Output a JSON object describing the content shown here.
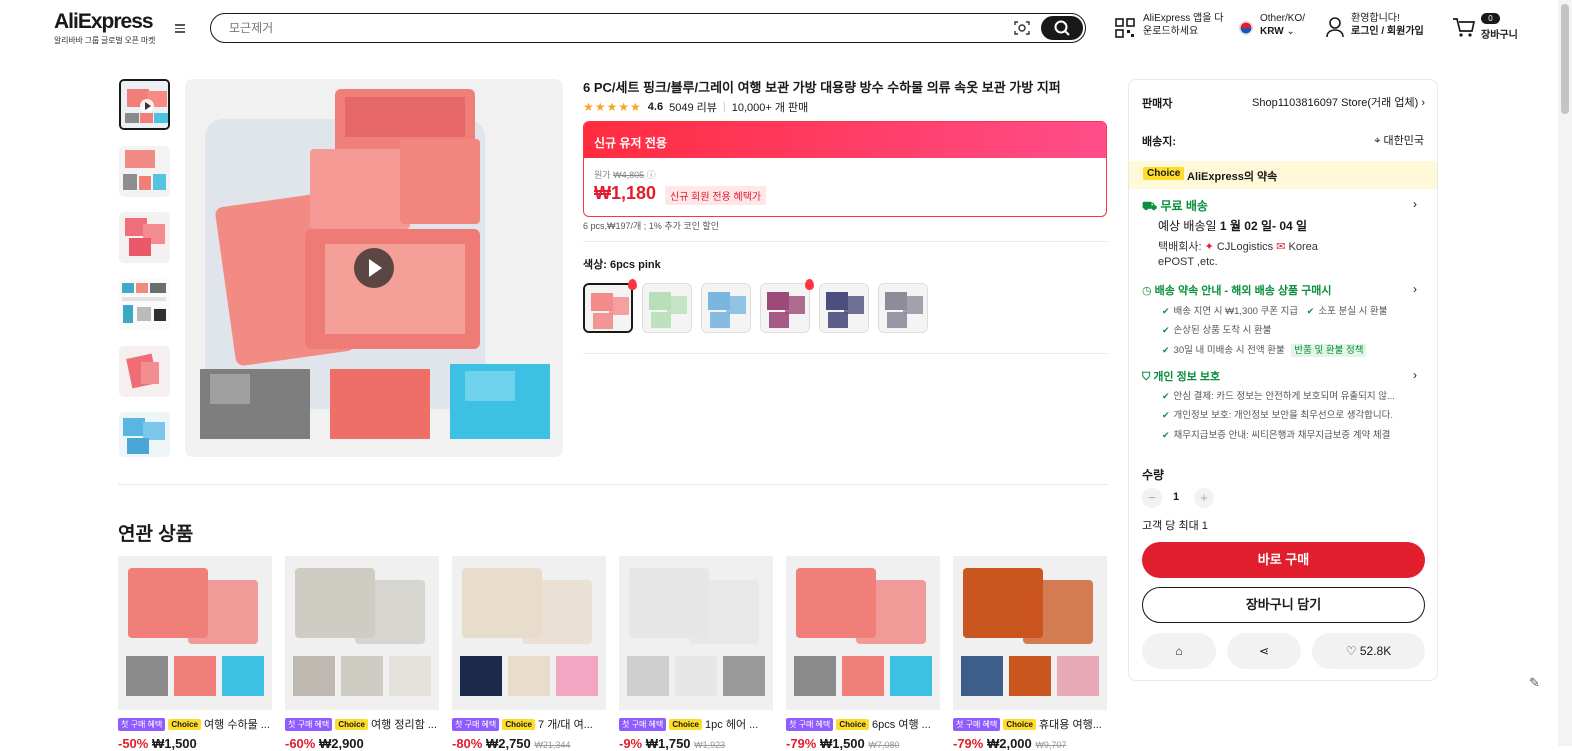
{
  "header": {
    "brand": "AliExpress",
    "brand_sub": "알리바바 그룹 글로벌 오픈 마켓",
    "search_placeholder": "모근제거",
    "app_line1": "AliExpress 앱을 다",
    "app_line2": "운로드하세요",
    "region_line1": "Other/KO/",
    "region_line2": "KRW",
    "login_line1": "환영합니다!",
    "login_line2": "로그인 / 회원가입",
    "cart_count": "0",
    "cart_label": "장바구니"
  },
  "product": {
    "title": "6 PC/세트 핑크/블루/그레이 여행 보관 가방 대용량 방수 수하물 의류 속옷 보관 가방 지퍼",
    "rating": "4.6",
    "reviews": "5049 리뷰",
    "sold": "10,000+ 개 판매",
    "promo_title": "신규 유저 전용",
    "orig_label": "원가",
    "orig_price": "₩4,805",
    "price": "₩1,180",
    "new_badge": "신규 회원 전용 혜택가",
    "unit_note": "6 pcs,₩197/개 ; 1% 추가 코인 할인",
    "color_label": "색상:",
    "color_value": "6pcs pink",
    "swatches": [
      {
        "name": "pink",
        "color": "#f48b8b"
      },
      {
        "name": "green",
        "color": "#b9dfb9"
      },
      {
        "name": "blue",
        "color": "#79b7e0"
      },
      {
        "name": "purple",
        "color": "#9c4a78"
      },
      {
        "name": "navy",
        "color": "#4c4f7e"
      },
      {
        "name": "gray",
        "color": "#8c8d99"
      }
    ]
  },
  "related": {
    "heading": "연관 상품",
    "tag_first": "첫 구매 혜택",
    "tag_choice": "Choice",
    "items": [
      {
        "title": "여행 수하물 ...",
        "pct": "-50%",
        "price": "₩1,500",
        "old": ""
      },
      {
        "title": "여행 정리함 ...",
        "pct": "-60%",
        "price": "₩2,900",
        "old": ""
      },
      {
        "title": "7 개/대 여...",
        "pct": "-80%",
        "price": "₩2,750",
        "old": "₩21,344"
      },
      {
        "title": "1pc 헤어 ...",
        "pct": "-9%",
        "price": "₩1,750",
        "old": "₩1,923"
      },
      {
        "title": "6pcs 여행 ...",
        "pct": "-79%",
        "price": "₩1,500",
        "old": "₩7,080"
      },
      {
        "title": "휴대용 여행...",
        "pct": "-79%",
        "price": "₩2,000",
        "old": "₩9,707"
      }
    ]
  },
  "panel": {
    "seller_label": "판매자",
    "seller_value": "Shop1103816097 Store(거래 업체)",
    "ship_label": "배송지:",
    "ship_value": "대한민국",
    "choice_tag": "Choice",
    "choice_text": "AliExpress의 약속",
    "free_ship": "무료 배송",
    "eta_prefix": "예상 배송일",
    "eta": "1 월 02 일- 04 일",
    "courier_label": "택배회사:",
    "courier_1": "CJLogistics",
    "courier_2": "Korea",
    "courier_3": "ePOST ,etc.",
    "promise_title": "배송 약속 안내 - 해외 배송 상품 구매시",
    "promise_1a": "배송 지연 시 ₩1,300 쿠폰 지급",
    "promise_1b": "소포 분실 시 환불",
    "promise_2": "손상된 상품 도착 시 환불",
    "promise_3": "30일 내 미배송 시 전액 환불",
    "refund_badge": "반품 및 환불 정책",
    "privacy_title": "개인 정보 보호",
    "privacy_1": "안심 결제: 카드 정보는 안전하게 보호되며 유출되지 않...",
    "privacy_2": "개인정보 보호: 개인정보 보안을 최우선으로 생각합니다.",
    "privacy_3": "채무지급보증 안내: 씨티은행과 채무지급보증 계약 체결",
    "qty_label": "수량",
    "qty": "1",
    "limit": "고객 당 최대 1",
    "buy_now": "바로 구매",
    "add_cart": "장바구니 담기",
    "wish_count": "52.8K"
  }
}
